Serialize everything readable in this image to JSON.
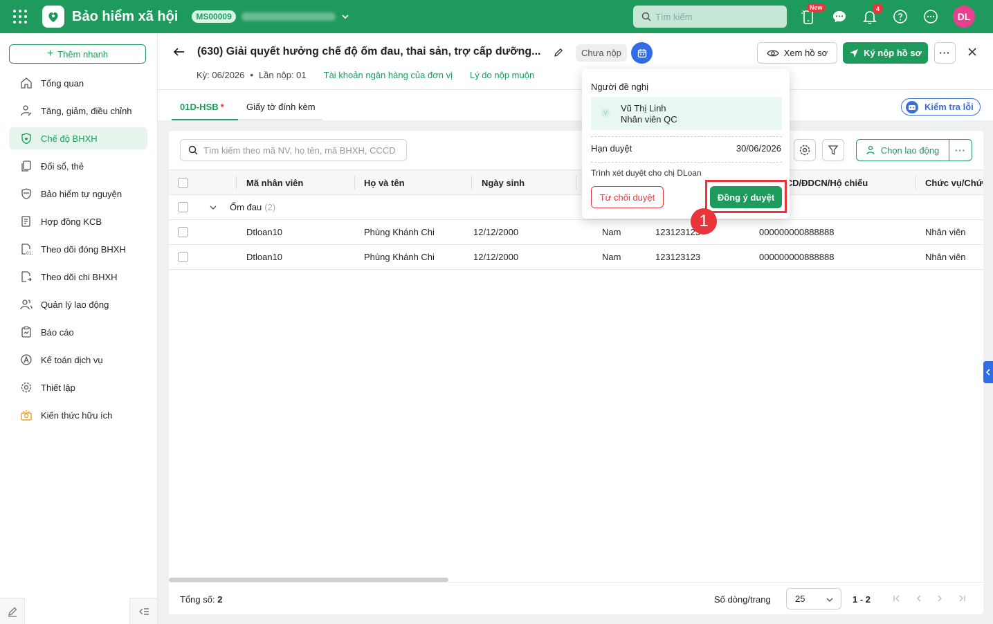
{
  "topbar": {
    "app_title": "Bảo hiểm xã hội",
    "org_code": "MS00009",
    "search_placeholder": "Tìm kiếm",
    "new_badge": "New",
    "notification_count": "4",
    "avatar_initials": "DL",
    "brand_color": "#1e9a5c"
  },
  "sidebar": {
    "quick_add_label": "Thêm nhanh",
    "items": [
      {
        "label": "Tổng quan",
        "icon": "home-icon"
      },
      {
        "label": "Tăng, giảm, điều chỉnh",
        "icon": "user-edit-icon"
      },
      {
        "label": "Chế độ BHXH",
        "icon": "shield-heart-icon",
        "active": true
      },
      {
        "label": "Đổi sổ, thẻ",
        "icon": "cards-icon"
      },
      {
        "label": "Bảo hiểm tự nguyện",
        "icon": "shield-icon"
      },
      {
        "label": "Hợp đồng KCB",
        "icon": "contract-icon"
      },
      {
        "label": "Theo dõi đóng BHXH",
        "icon": "calendar-track-icon"
      },
      {
        "label": "Theo dõi chi BHXH",
        "icon": "payout-icon"
      },
      {
        "label": "Quản lý lao động",
        "icon": "users-icon"
      },
      {
        "label": "Báo cáo",
        "icon": "report-icon"
      },
      {
        "label": "Kế toán dịch vụ",
        "icon": "accounting-icon"
      },
      {
        "label": "Thiết lập",
        "icon": "gear-icon"
      },
      {
        "label": "Kiến thức hữu ích",
        "icon": "knowledge-icon"
      }
    ]
  },
  "header": {
    "title": "(630) Giải quyết hưởng chế độ ốm đau, thai sản, trợ cấp dưỡng...",
    "status": "Chưa nộp",
    "period": "Kỳ: 06/2026",
    "submission": "Lần nộp: 01",
    "link_bank": "Tài khoản ngân hàng của đơn vị",
    "link_late": "Lý do nộp muộn",
    "view_btn": "Xem hồ sơ",
    "submit_btn": "Ký nộp hồ sơ"
  },
  "tabs": [
    {
      "label": "01D-HSB",
      "required": "*"
    },
    {
      "label": "Giấy tờ đính kèm"
    }
  ],
  "check_errors": "Kiểm tra lỗi",
  "grid": {
    "search_placeholder": "Tìm kiếm theo mã NV, họ tên, mã BHXH, CCCD",
    "choose_btn": "Chọn lao động",
    "columns": [
      "Mã nhân viên",
      "Họ và tên",
      "Ngày sinh",
      "CCCD/ĐDCN/Hộ chiếu",
      "Chức vụ/Chức"
    ],
    "group": {
      "label": "Ốm đau",
      "count": "(2)"
    },
    "rows": [
      {
        "code": "Dtloan10",
        "name": "Phùng Khánh Chi",
        "dob": "12/12/2000",
        "gender": "Nam",
        "bhxh": "123123123",
        "cccd": "000000000888888",
        "position": "Nhân viên"
      },
      {
        "code": "Dtloan10",
        "name": "Phùng Khánh Chi",
        "dob": "12/12/2000",
        "gender": "Nam",
        "bhxh": "123123123",
        "cccd": "000000000888888",
        "position": "Nhân viên"
      }
    ],
    "total_label": "Tổng số:",
    "total_value": "2",
    "rows_per_page_label": "Số dòng/trang",
    "page_size": "25",
    "page_range": "1 - 2"
  },
  "popover": {
    "title": "Người đề nghị",
    "person_name": "Vũ Thị Linh",
    "person_role": "Nhân viên QC",
    "due_label": "Hạn duyệt",
    "due_value": "30/06/2026",
    "note": "Trình xét duyệt cho chị DLoan",
    "reject_btn": "Từ chối duyệt",
    "approve_btn": "Đồng ý duyệt"
  },
  "callout_number": "1"
}
